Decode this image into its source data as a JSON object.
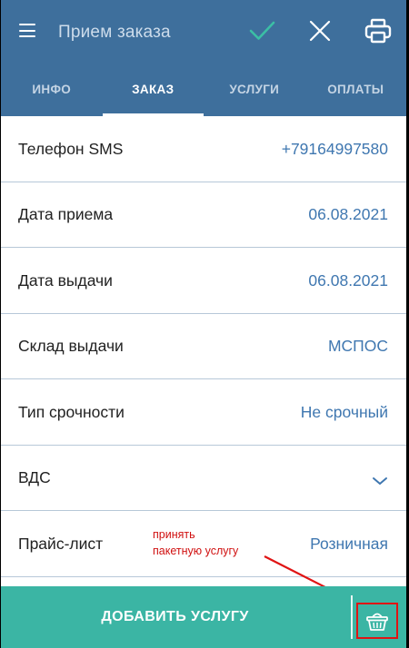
{
  "app_bar": {
    "title": "Прием заказа",
    "icons": [
      "menu-icon",
      "check-icon",
      "close-icon",
      "printer-icon"
    ]
  },
  "tabs": [
    {
      "label": "ИНФО",
      "active": false
    },
    {
      "label": "ЗАКАЗ",
      "active": true
    },
    {
      "label": "УСЛУГИ",
      "active": false
    },
    {
      "label": "ОПЛАТЫ",
      "active": false
    }
  ],
  "rows": [
    {
      "label": "Телефон SMS",
      "value": "+79164997580"
    },
    {
      "label": "Дата приема",
      "value": "06.08.2021"
    },
    {
      "label": "Дата выдачи",
      "value": "06.08.2021"
    },
    {
      "label": "Склад выдачи",
      "value": "МСПОС"
    },
    {
      "label": "Тип срочности",
      "value": "Не срочный"
    },
    {
      "label": "ВДС",
      "value": ""
    },
    {
      "label": "Прайс-лист",
      "value": "Розничная"
    }
  ],
  "annotation": {
    "line1": "принять",
    "line2": "пакетную услугу"
  },
  "bottom_bar": {
    "add_label": "ДОБАВИТЬ УСЛУГУ",
    "basket_icon": "basket-icon"
  },
  "colors": {
    "header": "#3e6f9c",
    "accent_value": "#3f77b0",
    "bottom_bar": "#3bb5a4",
    "check": "#3bbfa5",
    "annotation": "#d01010"
  }
}
